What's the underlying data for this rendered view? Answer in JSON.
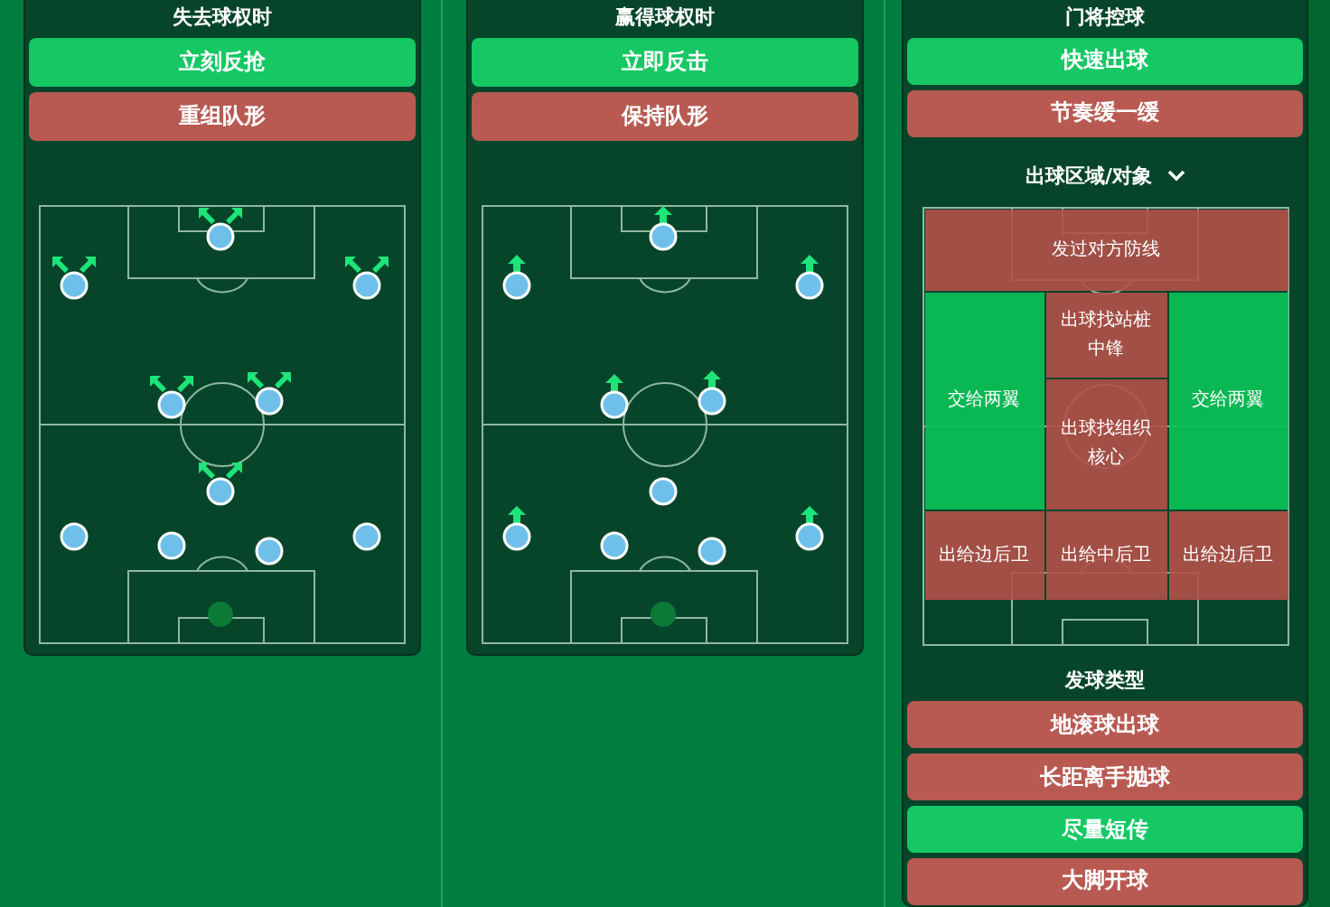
{
  "panels": [
    {
      "title": "失去球权时",
      "kind": "pressing",
      "options": [
        {
          "label": "立刻反抢",
          "selected": true
        },
        {
          "label": "重组队形",
          "selected": false
        }
      ],
      "players": [
        {
          "kind": "outfield",
          "arrows": true
        },
        {
          "kind": "outfield",
          "arrows": true
        },
        {
          "kind": "outfield",
          "arrows": true
        },
        {
          "kind": "outfield",
          "arrows": true
        },
        {
          "kind": "outfield",
          "arrows": true
        },
        {
          "kind": "outfield",
          "arrows": true
        },
        {
          "kind": "outfield",
          "arrows": false
        },
        {
          "kind": "outfield",
          "arrows": false
        },
        {
          "kind": "outfield",
          "arrows": false
        },
        {
          "kind": "outfield",
          "arrows": false
        },
        {
          "kind": "goalkeeper",
          "arrows": false
        }
      ]
    },
    {
      "title": "赢得球权时",
      "kind": "forward",
      "options": [
        {
          "label": "立即反击",
          "selected": true
        },
        {
          "label": "保持队形",
          "selected": false
        }
      ],
      "players": [
        {
          "kind": "outfield",
          "arrows": true
        },
        {
          "kind": "outfield",
          "arrows": true
        },
        {
          "kind": "outfield",
          "arrows": true
        },
        {
          "kind": "outfield",
          "arrows": true
        },
        {
          "kind": "outfield",
          "arrows": true
        },
        {
          "kind": "outfield",
          "arrows": false
        },
        {
          "kind": "outfield",
          "arrows": true
        },
        {
          "kind": "outfield",
          "arrows": false
        },
        {
          "kind": "outfield",
          "arrows": false
        },
        {
          "kind": "outfield",
          "arrows": true
        },
        {
          "kind": "goalkeeper",
          "arrows": false
        }
      ]
    }
  ],
  "goalkeeper_panel": {
    "title": "门将控球",
    "options": [
      {
        "label": "快速出球",
        "selected": true
      },
      {
        "label": "节奏缓一缓",
        "selected": false
      }
    ],
    "zone_heading": "出球区域/对象",
    "zones": [
      {
        "label": "发过对方防线",
        "selected": false
      },
      {
        "label": "交给两翼",
        "selected": true
      },
      {
        "label": "出球找站桩中锋",
        "selected": false
      },
      {
        "label": "出球找组织核心",
        "selected": false
      },
      {
        "label": "交给两翼",
        "selected": true
      },
      {
        "label": "出给边后卫",
        "selected": false
      },
      {
        "label": "出给中后卫",
        "selected": false
      },
      {
        "label": "出给边后卫",
        "selected": false
      }
    ],
    "distribution_heading": "发球类型",
    "distribution": [
      {
        "label": "地滚球出球",
        "selected": false
      },
      {
        "label": "长距离手抛球",
        "selected": false
      },
      {
        "label": "尽量短传",
        "selected": true
      },
      {
        "label": "大脚开球",
        "selected": false
      }
    ]
  }
}
